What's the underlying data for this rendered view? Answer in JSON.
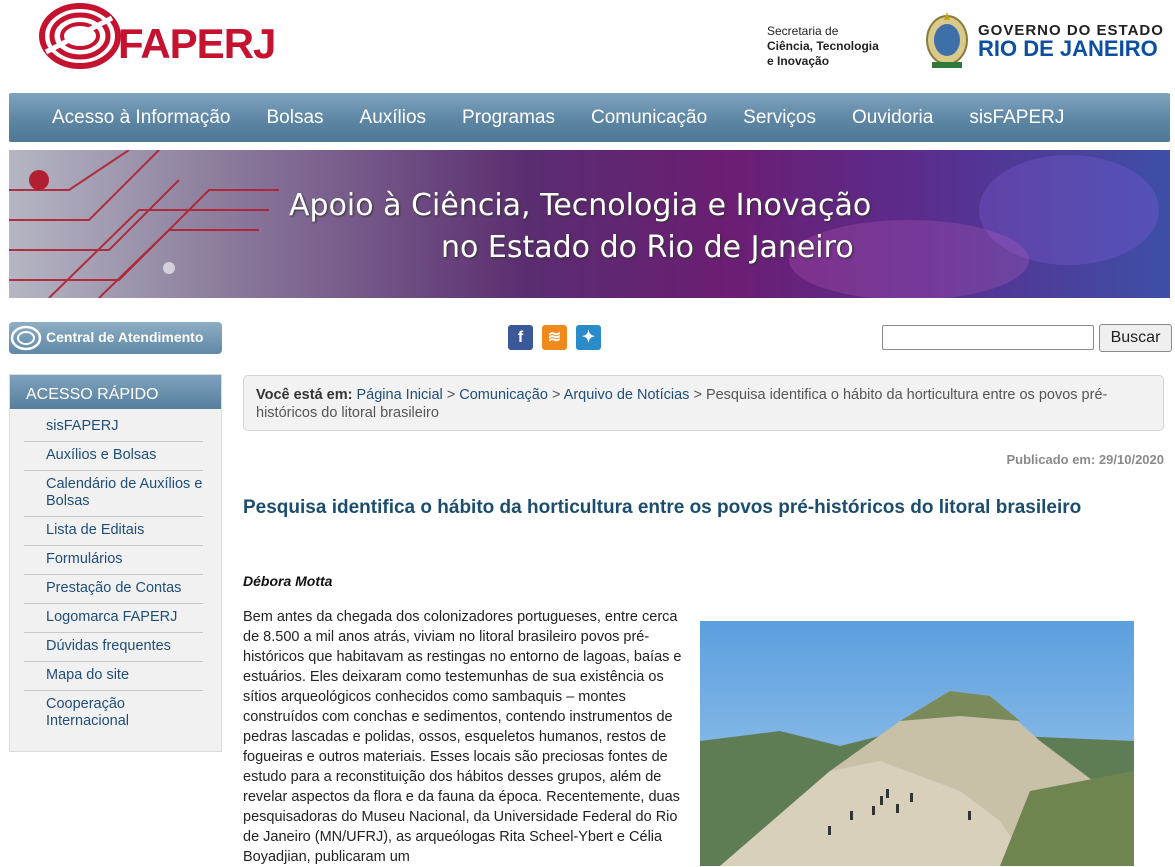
{
  "header": {
    "brand": "FAPERJ",
    "secretaria_line1": "Secretaria de",
    "secretaria_line2": "Ciência, Tecnologia",
    "secretaria_line3": "e Inovação",
    "gov_line1": "GOVERNO DO ESTADO",
    "gov_line2": "RIO DE JANEIRO"
  },
  "nav": {
    "items": [
      "Acesso à Informação",
      "Bolsas",
      "Auxílios",
      "Programas",
      "Comunicação",
      "Serviços",
      "Ouvidoria",
      "sisFAPERJ"
    ]
  },
  "banner": {
    "line1": "Apoio à Ciência, Tecnologia e Inovação",
    "line2": "no Estado do Rio de Janeiro"
  },
  "quickbar": {
    "central_label": "Central de Atendimento",
    "search_placeholder": "",
    "search_button": "Buscar",
    "social_icons": [
      "facebook-icon",
      "rss-icon",
      "twitter-icon"
    ]
  },
  "sidebar": {
    "title": "ACESSO RÁPIDO",
    "items": [
      "sisFAPERJ",
      "Auxílios e Bolsas",
      "Calendário de Auxílios e Bolsas",
      "Lista de Editais",
      "Formulários",
      "Prestação de Contas",
      "Logomarca FAPERJ",
      "Dúvidas frequentes",
      "Mapa do site",
      "Cooperação Internacional"
    ]
  },
  "breadcrumb": {
    "prefix": "Você está em:",
    "home": "Página Inicial",
    "section": "Comunicação",
    "archive": "Arquivo de Notícias",
    "current": "Pesquisa identifica o hábito da horticultura entre os povos pré-históricos do litoral brasileiro",
    "sep": ">"
  },
  "article": {
    "published": "Publicado em: 29/10/2020",
    "title": "Pesquisa identifica o hábito da horticultura entre os povos pré-históricos do litoral brasileiro",
    "author": "Débora Motta",
    "body": "Bem antes da chegada dos colonizadores portugueses, entre cerca de 8.500 a mil anos atrás, viviam no litoral brasileiro povos pré-históricos que habitavam as restingas no entorno de lagoas, baías e estuários. Eles deixaram como testemunhas de sua existência os sítios arqueológicos conhecidos como sambaquis – montes construídos com conchas e sedimentos, contendo instrumentos de pedras lascadas e polidas, ossos, esqueletos humanos, restos de fogueiras e outros materiais. Esses locais são preciosas fontes de estudo para a reconstituição dos hábitos desses grupos, além de revelar aspectos da flora e da fauna da época. Recentemente, duas pesquisadoras do Museu Nacional, da Universidade Federal do Rio de Janeiro (MN/UFRJ), as arqueólogas Rita Scheel-Ybert e Célia Boyadjian, publicaram um"
  },
  "colors": {
    "brand_red": "#c4122f",
    "nav_blue": "#5d86a5",
    "title_blue": "#1b4d6e",
    "link_blue": "#1f4e79"
  }
}
